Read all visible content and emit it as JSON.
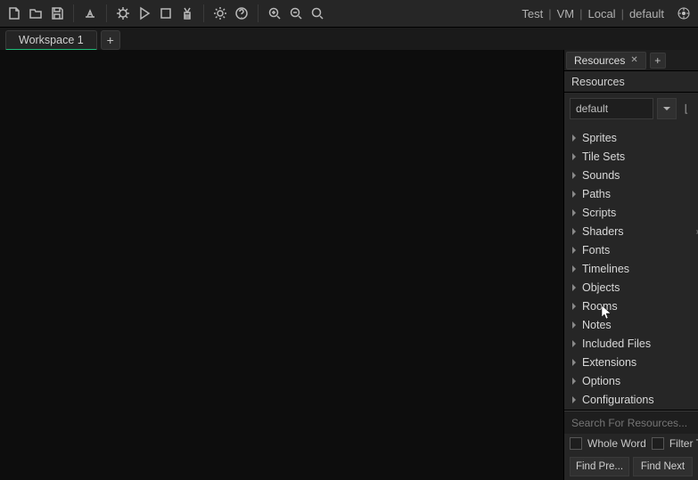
{
  "status": {
    "test": "Test",
    "vm": "VM",
    "local": "Local",
    "default": "default"
  },
  "workspace_tab": "Workspace 1",
  "resources": {
    "tab_label": "Resources",
    "panel_title": "Resources",
    "config_value": "default",
    "tree": [
      "Sprites",
      "Tile Sets",
      "Sounds",
      "Paths",
      "Scripts",
      "Shaders",
      "Fonts",
      "Timelines",
      "Objects",
      "Rooms",
      "Notes",
      "Included Files",
      "Extensions",
      "Options",
      "Configurations"
    ],
    "search_placeholder": "Search For Resources...",
    "chk_whole": "Whole Word",
    "chk_filter": "Filter Tree",
    "btn_prev": "Find Pre...",
    "btn_next": "Find Next"
  }
}
